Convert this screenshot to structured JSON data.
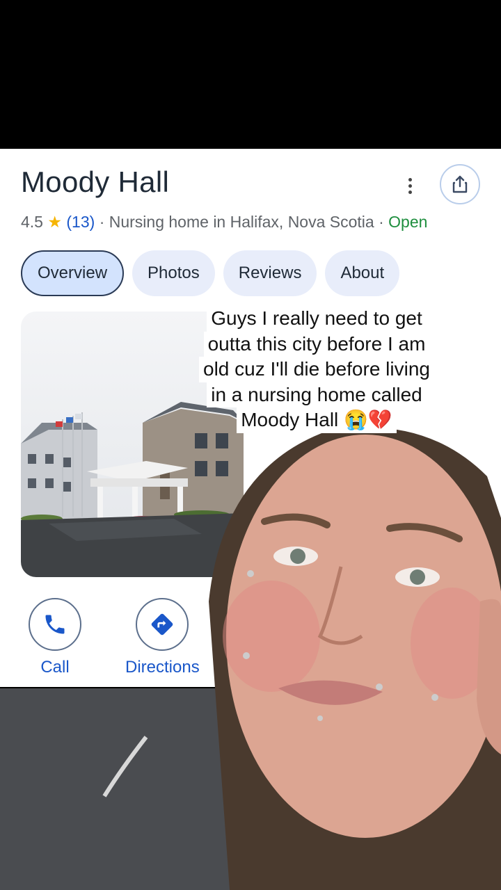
{
  "place": {
    "title": "Moody Hall",
    "rating": "4.5",
    "review_count": "(13)",
    "separator": "·",
    "category": "Nursing home in Halifax, Nova Scotia",
    "status": "Open"
  },
  "tabs": [
    "Overview",
    "Photos",
    "Reviews",
    "About"
  ],
  "actions": {
    "call_label": "Call",
    "directions_label": "Directions"
  },
  "caption": {
    "lines": [
      "Guys I really need to get",
      "outta this city before I am",
      "old cuz I'll die before living",
      "in a nursing home called",
      "Moody Hall 😭💔"
    ]
  },
  "icons": {
    "star": "star-icon",
    "more": "more-vert-icon",
    "share": "share-icon",
    "call": "phone-icon",
    "directions": "directions-icon"
  },
  "colors": {
    "accent_blue": "#1a57c9",
    "open_green": "#1e8e3e",
    "star_gold": "#f6b400",
    "chip_bg": "#e8edfa"
  }
}
